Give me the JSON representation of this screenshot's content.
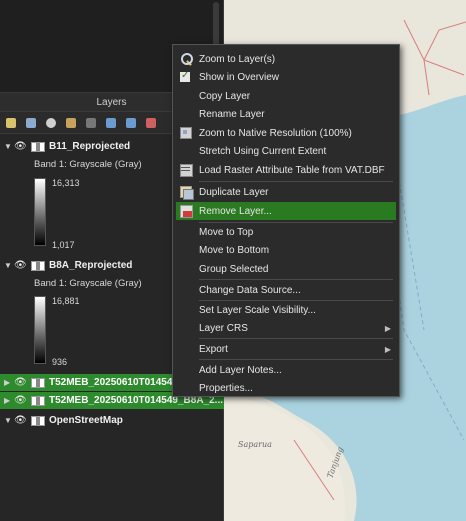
{
  "panel": {
    "title": "Layers"
  },
  "layers": [
    {
      "name": "B11_Reprojected",
      "band": "Band 1: Grayscale (Gray)",
      "max": "16,313",
      "min": "1,017"
    },
    {
      "name": "B8A_Reprojected",
      "band": "Band 1: Grayscale (Gray)",
      "max": "16,881",
      "min": "936"
    },
    {
      "name": "T52MEB_20250610T014549",
      "selected": true
    },
    {
      "name": "T52MEB_20250610T014549_B8A_2...",
      "selected": true
    },
    {
      "name": "OpenStreetMap"
    }
  ],
  "menu": {
    "items": [
      {
        "label": "Zoom to Layer(s)",
        "icon": "zoom-icon"
      },
      {
        "label": "Show in Overview",
        "icon": "overview-check-icon"
      },
      {
        "label": "Copy Layer",
        "icon": ""
      },
      {
        "label": "Rename Layer",
        "icon": ""
      },
      {
        "label": "Zoom to Native Resolution (100%)",
        "icon": "native-resolution-icon"
      },
      {
        "label": "Stretch Using Current Extent",
        "icon": ""
      },
      {
        "label": "Load Raster Attribute Table from VAT.DBF",
        "icon": "attribute-table-icon"
      },
      {
        "label": "Duplicate Layer",
        "icon": "duplicate-icon"
      },
      {
        "label": "Remove Layer...",
        "icon": "remove-layer-icon",
        "highlighted": true
      },
      {
        "label": "Move to Top",
        "icon": ""
      },
      {
        "label": "Move to Bottom",
        "icon": ""
      },
      {
        "label": "Group Selected",
        "icon": ""
      },
      {
        "label": "Change Data Source...",
        "icon": ""
      },
      {
        "label": "Set Layer Scale Visibility...",
        "icon": ""
      },
      {
        "label": "Layer CRS",
        "icon": "",
        "submenu": true
      },
      {
        "label": "Export",
        "icon": "",
        "submenu": true
      },
      {
        "label": "Add Layer Notes...",
        "icon": ""
      },
      {
        "label": "Properties...",
        "icon": ""
      }
    ]
  },
  "map": {
    "labels": [
      "Saparua",
      "Tanjung"
    ]
  },
  "colors": {
    "selection": "#2d8a2d",
    "menu_highlight": "#2a7a22",
    "map_land": "#e9e6dc",
    "map_sea": "#aad3df"
  }
}
